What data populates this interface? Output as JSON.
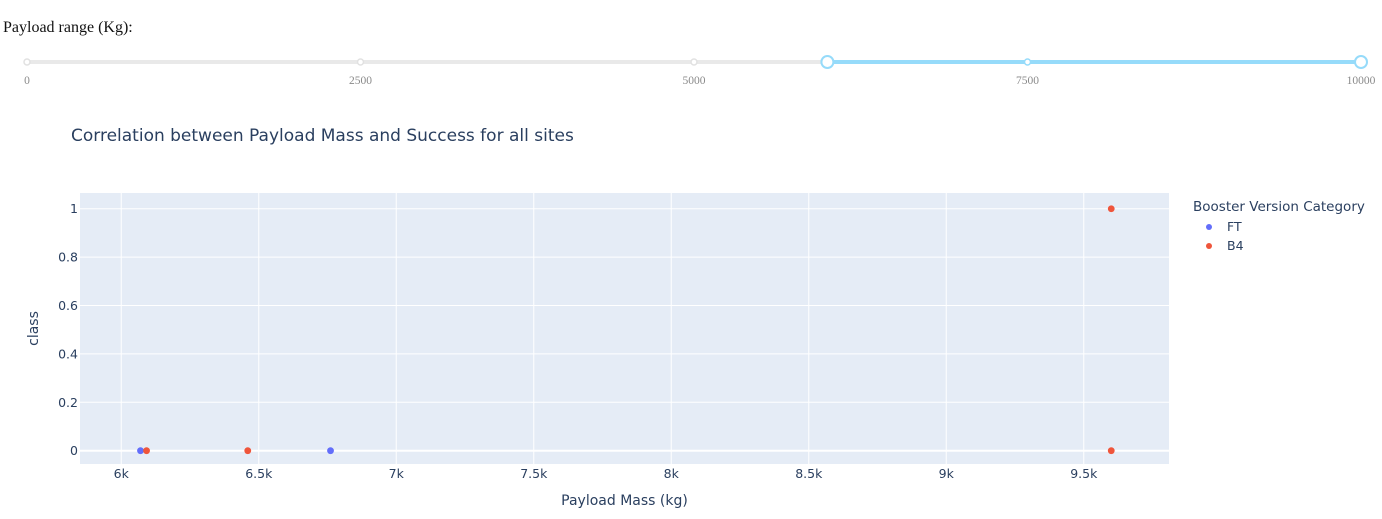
{
  "slider": {
    "label": "Payload range (Kg):",
    "min": 0,
    "max": 10000,
    "marks": [
      "0",
      "2500",
      "5000",
      "7500",
      "10000"
    ],
    "mark_values": [
      0,
      2500,
      5000,
      7500,
      10000
    ],
    "range": [
      6000,
      10000
    ],
    "track_color": "#e9e9e9",
    "active_color": "#96dbfa"
  },
  "chart_data": {
    "type": "scatter",
    "title": "Correlation between Payload Mass and Success for all sites",
    "xlabel": "Payload Mass (kg)",
    "ylabel": "class",
    "xlim": [
      5850,
      9810
    ],
    "ylim": [
      -0.055,
      1.065
    ],
    "x_ticks": [
      6000,
      6500,
      7000,
      7500,
      8000,
      8500,
      9000,
      9500
    ],
    "x_tick_labels": [
      "6k",
      "6.5k",
      "7k",
      "7.5k",
      "8k",
      "8.5k",
      "9k",
      "9.5k"
    ],
    "y_ticks": [
      0,
      0.2,
      0.4,
      0.6,
      0.8,
      1
    ],
    "y_tick_labels": [
      "0",
      "0.2",
      "0.4",
      "0.6",
      "0.8",
      "1"
    ],
    "grid": true,
    "legend_title": "Booster Version Category",
    "legend_position": "right",
    "series": [
      {
        "name": "FT",
        "color": "#636efa",
        "points": [
          [
            6070,
            0
          ],
          [
            6761,
            0
          ]
        ]
      },
      {
        "name": "B4",
        "color": "#ef553b",
        "points": [
          [
            6092,
            0
          ],
          [
            6460,
            0
          ],
          [
            9600,
            1
          ],
          [
            9600,
            0
          ]
        ]
      }
    ]
  }
}
